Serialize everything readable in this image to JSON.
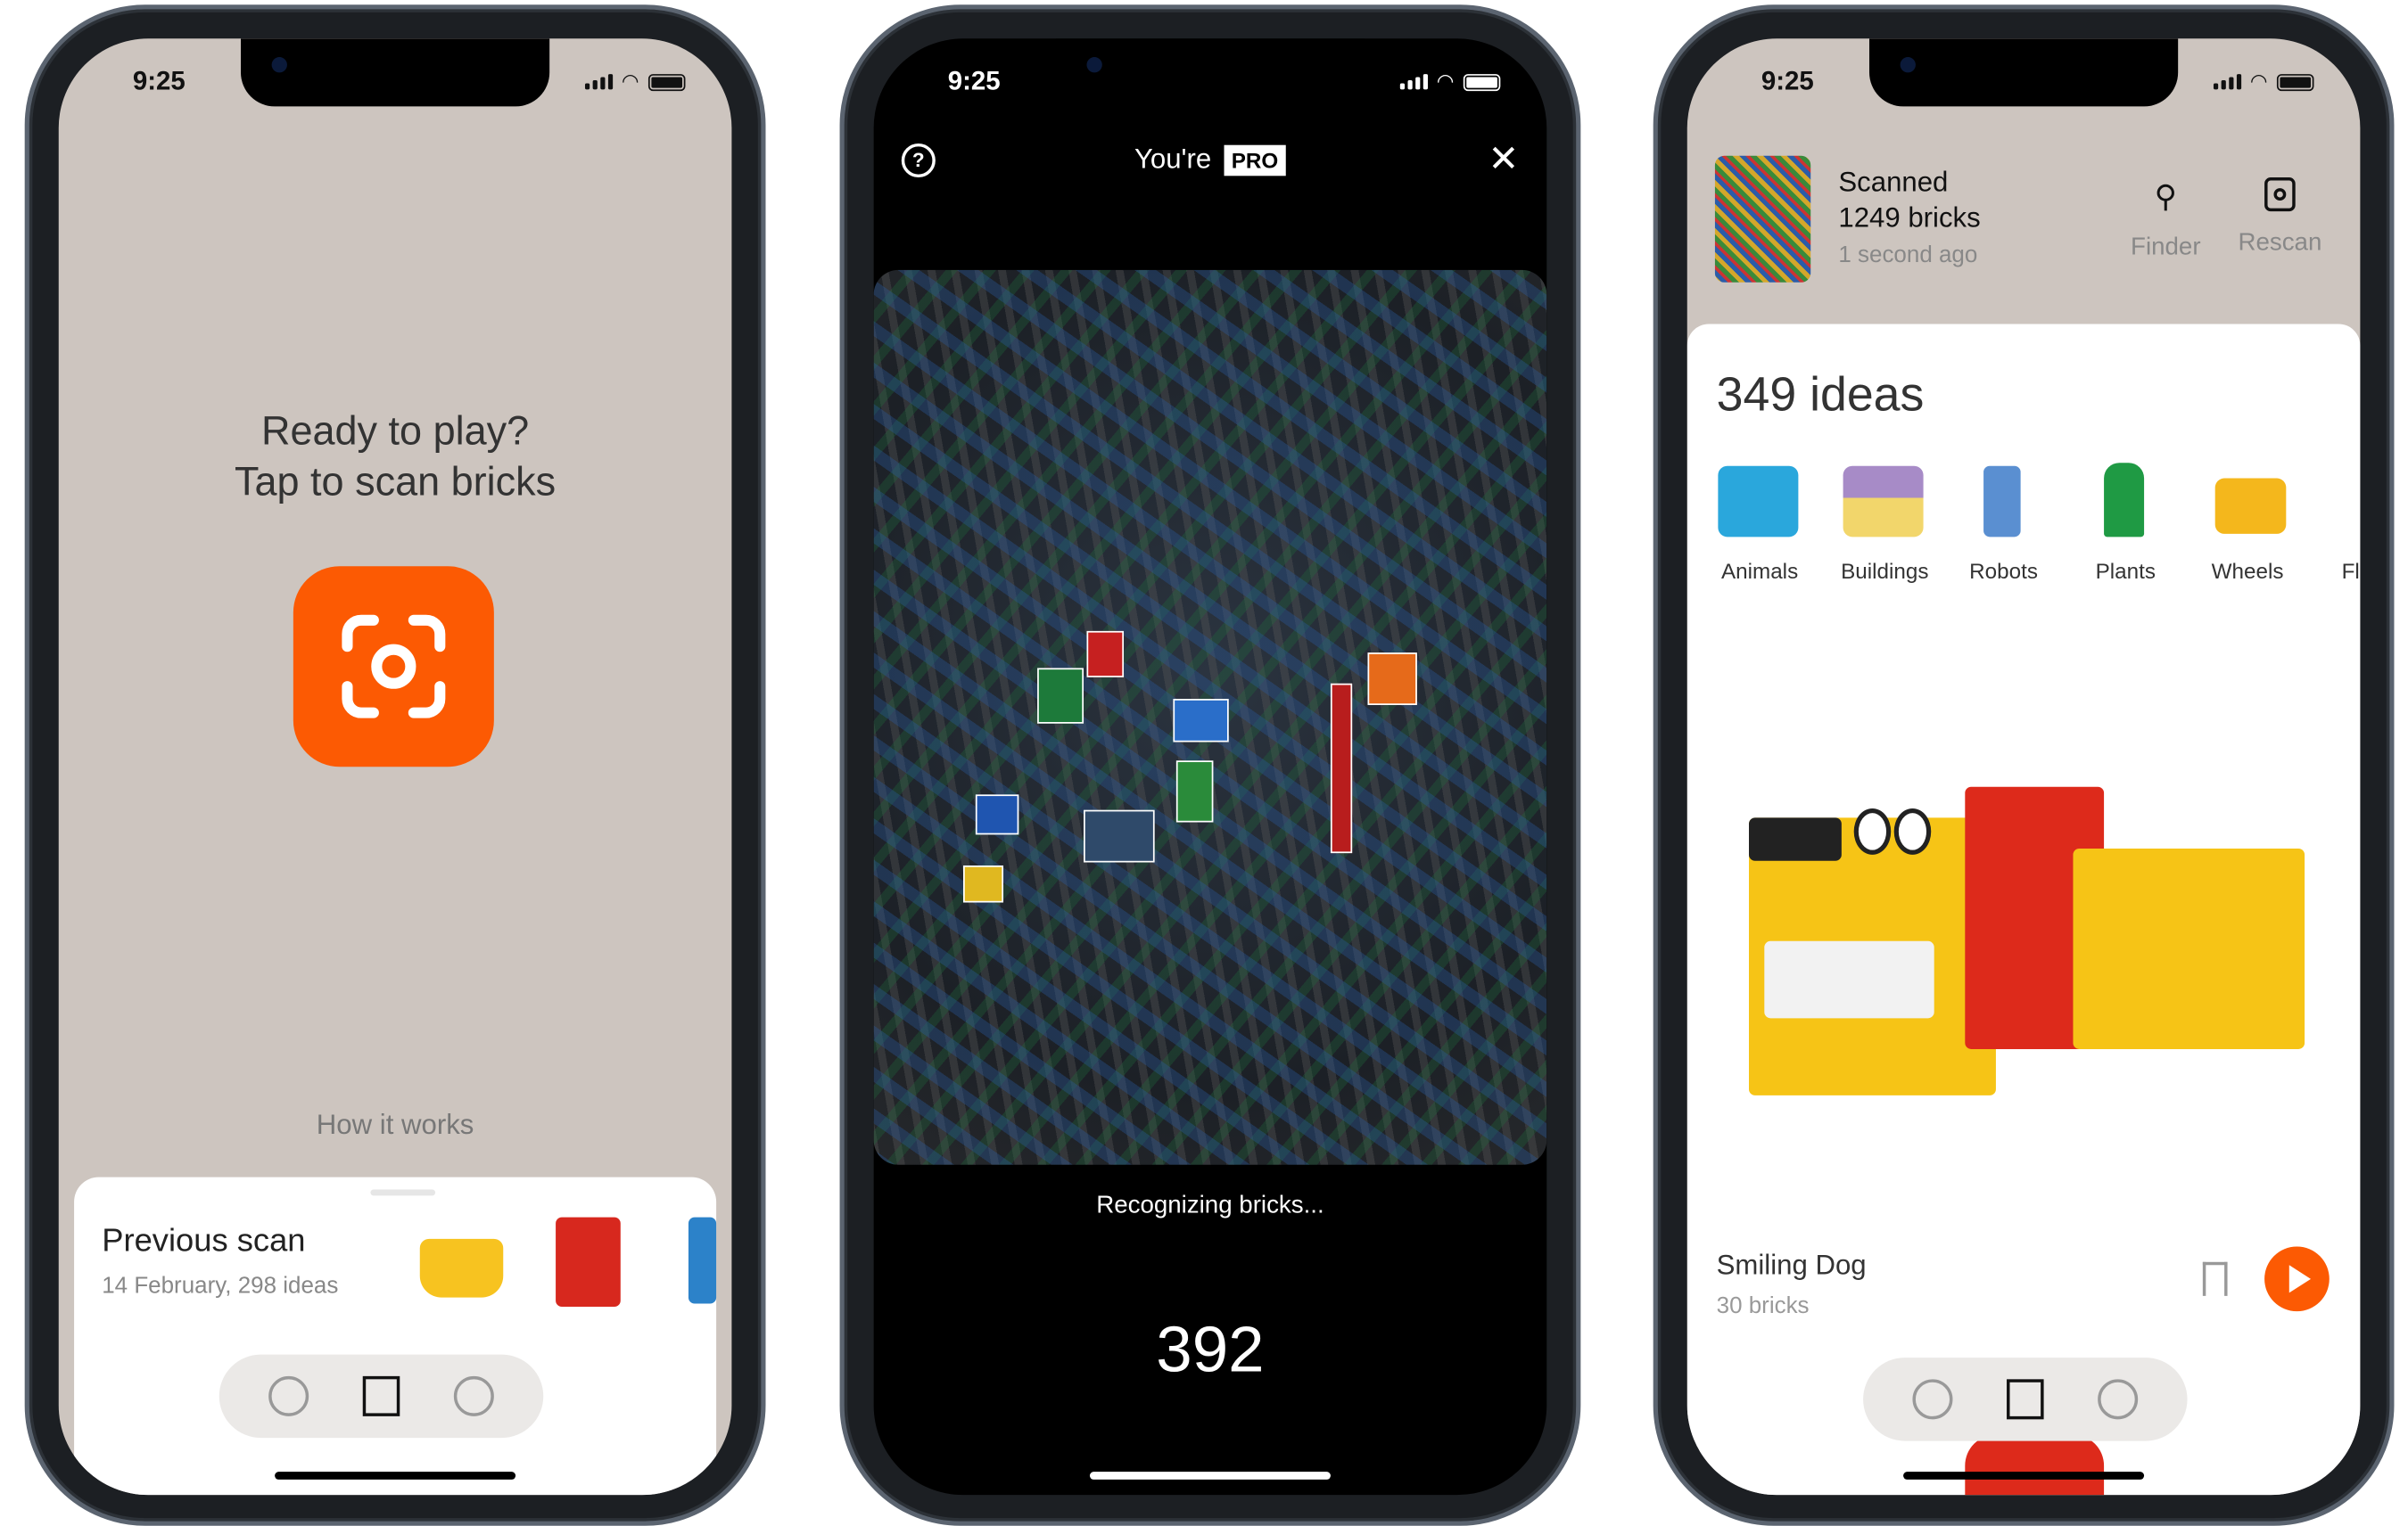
{
  "colors": {
    "accent": "#fc5a03",
    "beige": "#cdc5bf",
    "dark": "#000000"
  },
  "phone1": {
    "status": {
      "time": "9:25"
    },
    "headline_line1": "Ready to play?",
    "headline_line2": "Tap to scan bricks",
    "scan_button_icon": "camera-scan-icon",
    "how_it_works": "How it works",
    "previous_scan": {
      "title": "Previous scan",
      "subtitle": "14 February, 298 ideas"
    },
    "tabbar": {
      "icons": [
        "globe-icon",
        "bricks-icon",
        "face-icon"
      ]
    }
  },
  "phone2": {
    "status": {
      "time": "9:25"
    },
    "title_prefix": "You're",
    "pro_badge": "PRO",
    "help_icon": "help-icon",
    "close_icon": "close-icon",
    "status_text": "Recognizing bricks...",
    "count": "392"
  },
  "phone3": {
    "status": {
      "time": "9:25"
    },
    "scan": {
      "title": "Scanned",
      "bricks": "1249 bricks",
      "time": "1 second ago"
    },
    "actions": [
      {
        "label": "Finder",
        "icon": "search-icon"
      },
      {
        "label": "Rescan",
        "icon": "camera-scan-icon"
      }
    ],
    "ideas_title": "349 ideas",
    "categories": [
      "Animals",
      "Buildings",
      "Robots",
      "Plants",
      "Wheels",
      "Fl"
    ],
    "featured": {
      "title": "Smiling Dog",
      "subtitle": "30 bricks"
    },
    "tabbar": {
      "icons": [
        "globe-icon",
        "bricks-icon",
        "face-icon"
      ]
    }
  }
}
